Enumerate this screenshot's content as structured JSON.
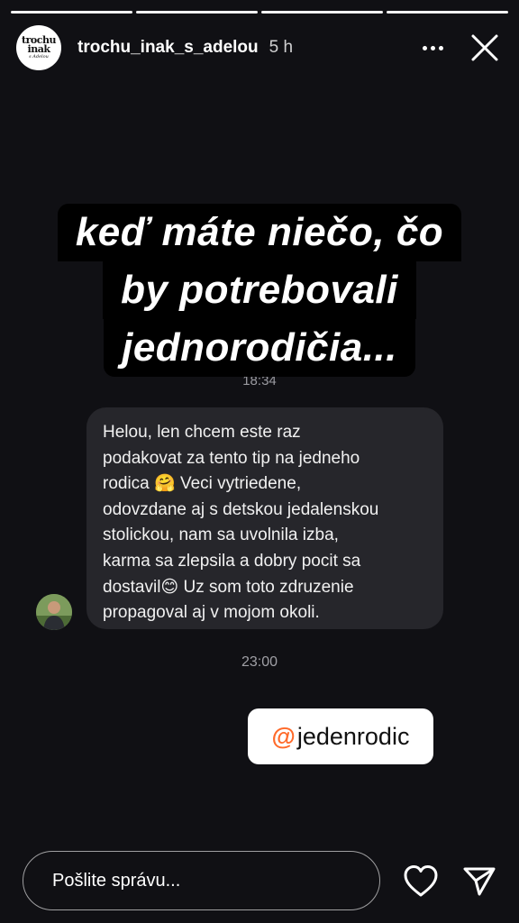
{
  "story": {
    "progress_segments": 4,
    "progress_completed": 3
  },
  "header": {
    "avatar_text": [
      "trochu",
      "inak",
      "s Adelou"
    ],
    "username": "trochu_inak_s_adelou",
    "time": "5 h",
    "more_icon": "more-horizontal-icon",
    "close_icon": "close-icon"
  },
  "caption": {
    "lines": [
      "keď máte niečo, čo",
      "by potrebovali",
      "jednorodičia..."
    ]
  },
  "screenshot": {
    "partial_timestamp": "18:34",
    "message": "Helou, len chcem este raz\npodakovat za tento tip na jedneho\nrodica 🤗 Veci vytriedene,\nodovzdane aj s detskou jedalenskou\nstolickou, nam sa uvolnila izba,\nkarma sa zlepsila a dobry pocit sa\ndostavil😊  Uz som toto zdruzenie\npropagoval aj v mojom okoli.",
    "timestamp": "23:00"
  },
  "mention_sticker": {
    "at_symbol": "@",
    "handle": "jedenrodic"
  },
  "footer": {
    "reply_placeholder": "Pošlite správu...",
    "like_icon": "heart-icon",
    "share_icon": "send-icon"
  }
}
